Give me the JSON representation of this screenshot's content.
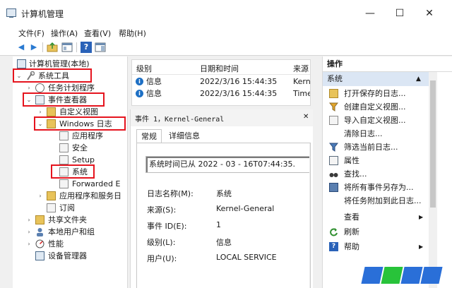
{
  "window": {
    "title": "计算机管理",
    "minimize": "—",
    "maximize": "☐",
    "close": "✕"
  },
  "menu": [
    "文件(F)",
    "操作(A)",
    "查看(V)",
    "帮助(H)"
  ],
  "toolbar": {
    "back": "◀",
    "forward": "▶",
    "help": "?"
  },
  "tree": [
    {
      "label": "计算机管理(本地)",
      "icon": "computer-icon",
      "twisty": ""
    },
    {
      "label": "系统工具",
      "icon": "tools-icon",
      "twisty": "⌄"
    },
    {
      "label": "任务计划程序",
      "icon": "clock-icon",
      "twisty": "›"
    },
    {
      "label": "事件查看器",
      "icon": "event-viewer-icon",
      "twisty": "⌄"
    },
    {
      "label": "自定义视图",
      "icon": "folder-icon",
      "twisty": "›"
    },
    {
      "label": "Windows 日志",
      "icon": "folder-icon",
      "twisty": "⌄"
    },
    {
      "label": "应用程序",
      "icon": "log-icon",
      "twisty": ""
    },
    {
      "label": "安全",
      "icon": "log-icon",
      "twisty": ""
    },
    {
      "label": "Setup",
      "icon": "log-icon",
      "twisty": ""
    },
    {
      "label": "系统",
      "icon": "log-icon",
      "twisty": ""
    },
    {
      "label": "Forwarded E",
      "icon": "log-icon",
      "twisty": ""
    },
    {
      "label": "应用程序和服务日",
      "icon": "folder-icon",
      "twisty": "›"
    },
    {
      "label": "订阅",
      "icon": "log-icon",
      "twisty": ""
    },
    {
      "label": "共享文件夹",
      "icon": "folder-icon",
      "twisty": "›"
    },
    {
      "label": "本地用户和组",
      "icon": "users-icon",
      "twisty": "›"
    },
    {
      "label": "性能",
      "icon": "performance-icon",
      "twisty": "›"
    },
    {
      "label": "设备管理器",
      "icon": "device-icon",
      "twisty": ""
    }
  ],
  "events": {
    "columns": [
      "级别",
      "日期和时间",
      "来源"
    ],
    "rows": [
      {
        "level": "信息",
        "datetime": "2022/3/16 15:44:35",
        "source": "Kern"
      },
      {
        "level": "信息",
        "datetime": "2022/3/16 15:44:35",
        "source": "Time"
      }
    ]
  },
  "detail": {
    "title": "事件 1，Kernel-General",
    "close": "✕",
    "tabs": [
      "常规",
      "详细信息"
    ],
    "description": "系统时间已从  2022 - 03 - 16T07:44:35.",
    "fields": [
      {
        "label": "日志名称(M):",
        "value": "系统"
      },
      {
        "label": "来源(S):",
        "value": "Kernel-General"
      },
      {
        "label": "事件 ID(E):",
        "value": "1"
      },
      {
        "label": "级别(L):",
        "value": "信息"
      },
      {
        "label": "用户(U):",
        "value": "LOCAL SERVICE"
      }
    ]
  },
  "actions": {
    "header": "操作",
    "section": "系统",
    "section_arrow": "▲",
    "items": [
      {
        "label": "打开保存的日志...",
        "icon": "open-folder-icon",
        "arrow": ""
      },
      {
        "label": "创建自定义视图...",
        "icon": "filter-icon",
        "arrow": ""
      },
      {
        "label": "导入自定义视图...",
        "icon": "import-icon",
        "arrow": ""
      },
      {
        "label": "清除日志...",
        "icon": "",
        "arrow": ""
      },
      {
        "label": "筛选当前日志...",
        "icon": "filter-icon",
        "arrow": ""
      },
      {
        "label": "属性",
        "icon": "properties-icon",
        "arrow": ""
      },
      {
        "label": "查找...",
        "icon": "find-icon",
        "arrow": ""
      },
      {
        "label": "将所有事件另存为...",
        "icon": "save-icon",
        "arrow": ""
      },
      {
        "label": "将任务附加到此日志...",
        "icon": "",
        "arrow": ""
      },
      {
        "label": "查看",
        "icon": "",
        "arrow": "▶"
      },
      {
        "label": "刷新",
        "icon": "refresh-icon",
        "arrow": ""
      },
      {
        "label": "帮助",
        "icon": "help-icon",
        "arrow": "▶"
      }
    ]
  }
}
